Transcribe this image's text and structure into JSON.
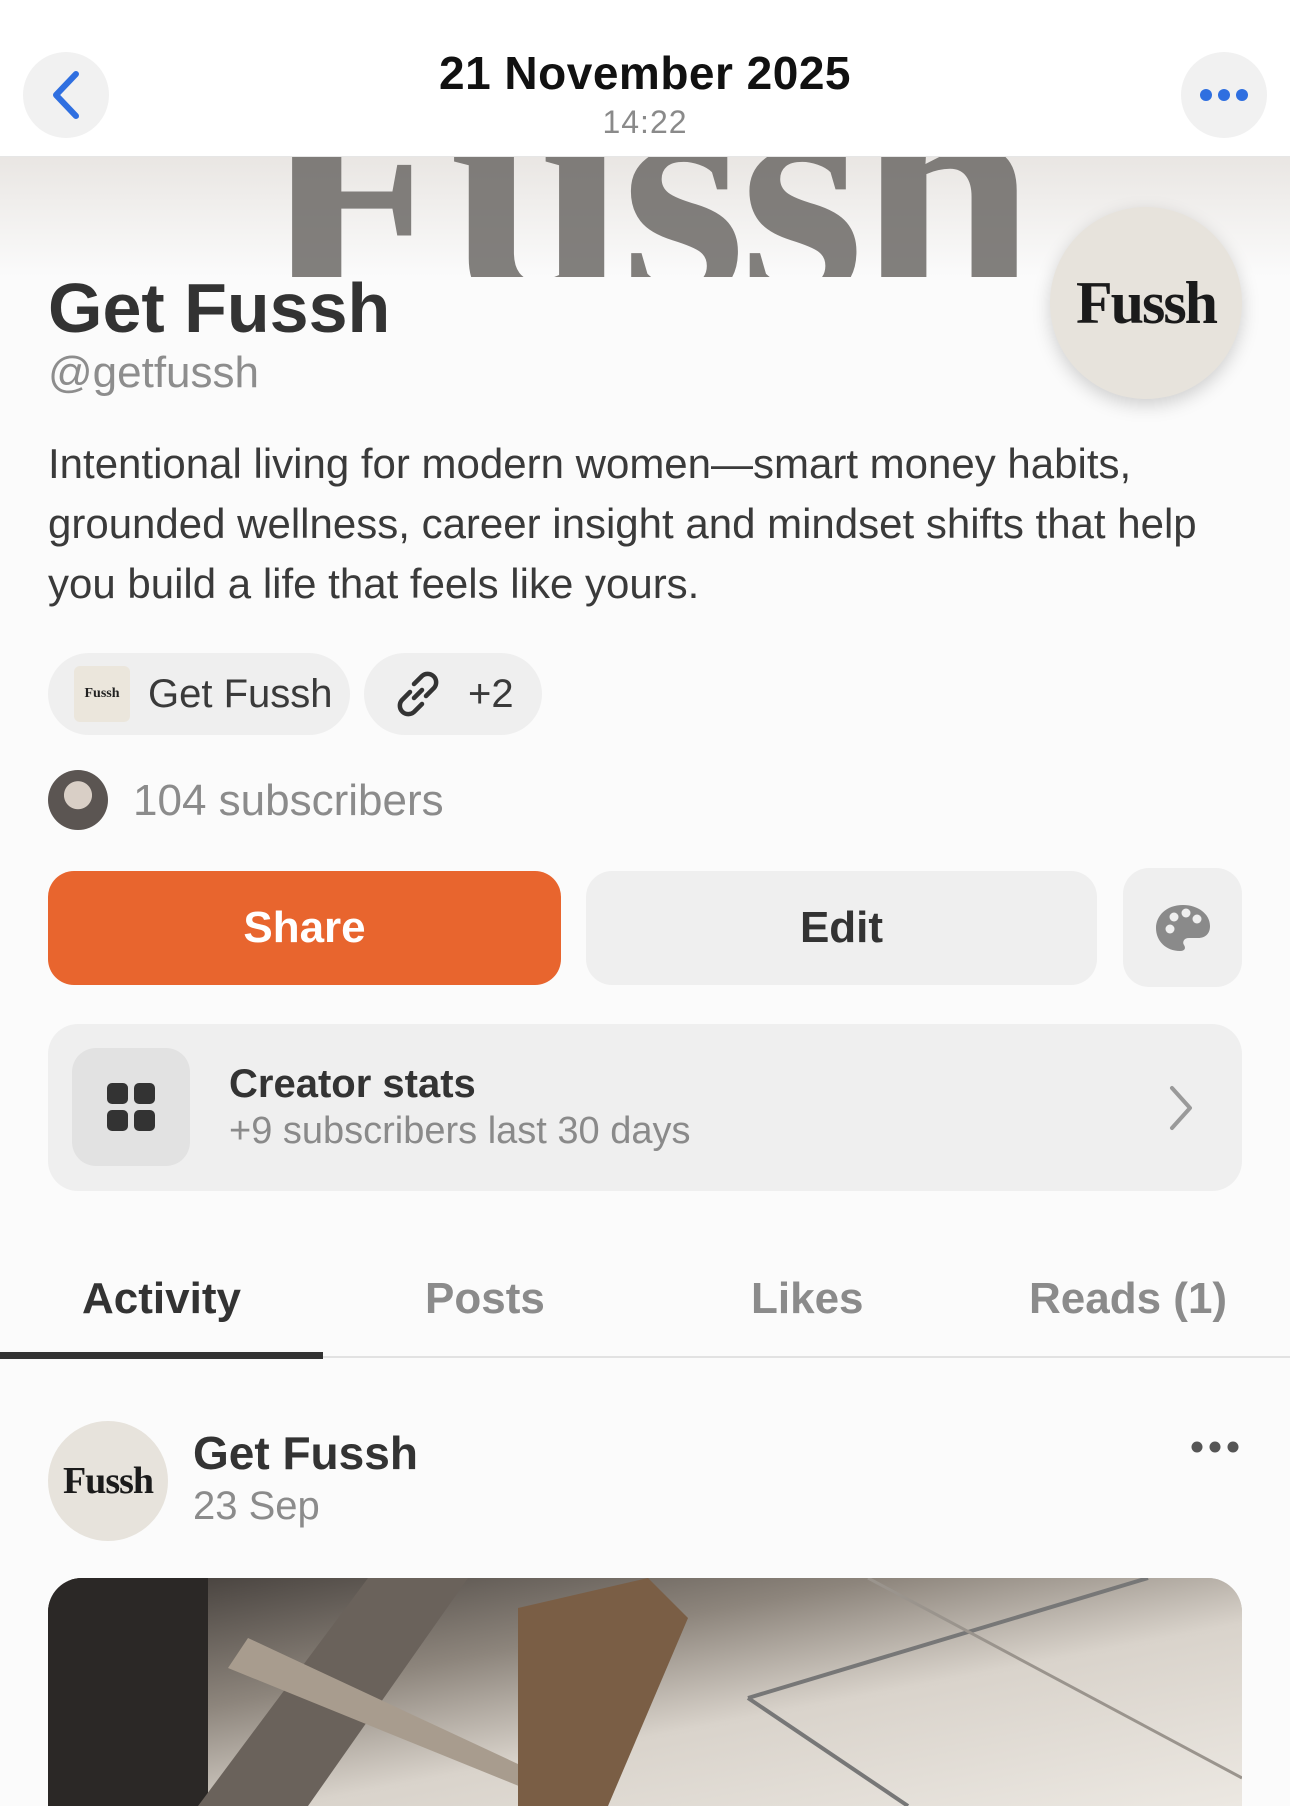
{
  "header": {
    "date": "21 November 2025",
    "time": "14:22"
  },
  "banner": {
    "word": "Fussh"
  },
  "profile": {
    "logo_text": "Fussh",
    "name": "Get Fussh",
    "handle": "@getfussh",
    "bio": "Intentional living for modern women—smart money habits, grounded wellness, career insight and mindset shifts that help you build a life that feels like yours."
  },
  "chips": {
    "site_thumb_text": "Fussh",
    "site_label": "Get Fussh",
    "links_label": "+2"
  },
  "subscribers": {
    "label": "104 subscribers"
  },
  "actions": {
    "share_label": "Share",
    "edit_label": "Edit"
  },
  "creator_stats": {
    "title": "Creator stats",
    "subtitle": "+9 subscribers last 30 days"
  },
  "tabs": [
    {
      "label": "Activity",
      "active": true
    },
    {
      "label": "Posts",
      "active": false
    },
    {
      "label": "Likes",
      "active": false
    },
    {
      "label": "Reads (1)",
      "active": false
    }
  ],
  "post": {
    "avatar_text": "Fussh",
    "author": "Get Fussh",
    "date": "23 Sep"
  },
  "colors": {
    "accent": "#e8652e",
    "ios_blue": "#2f6fe0"
  },
  "icons": {
    "back": "chevron-left-icon",
    "more": "ellipsis-icon",
    "link": "link-icon",
    "theme": "palette-icon",
    "stats": "grid-icon",
    "chevron": "chevron-right-icon"
  }
}
